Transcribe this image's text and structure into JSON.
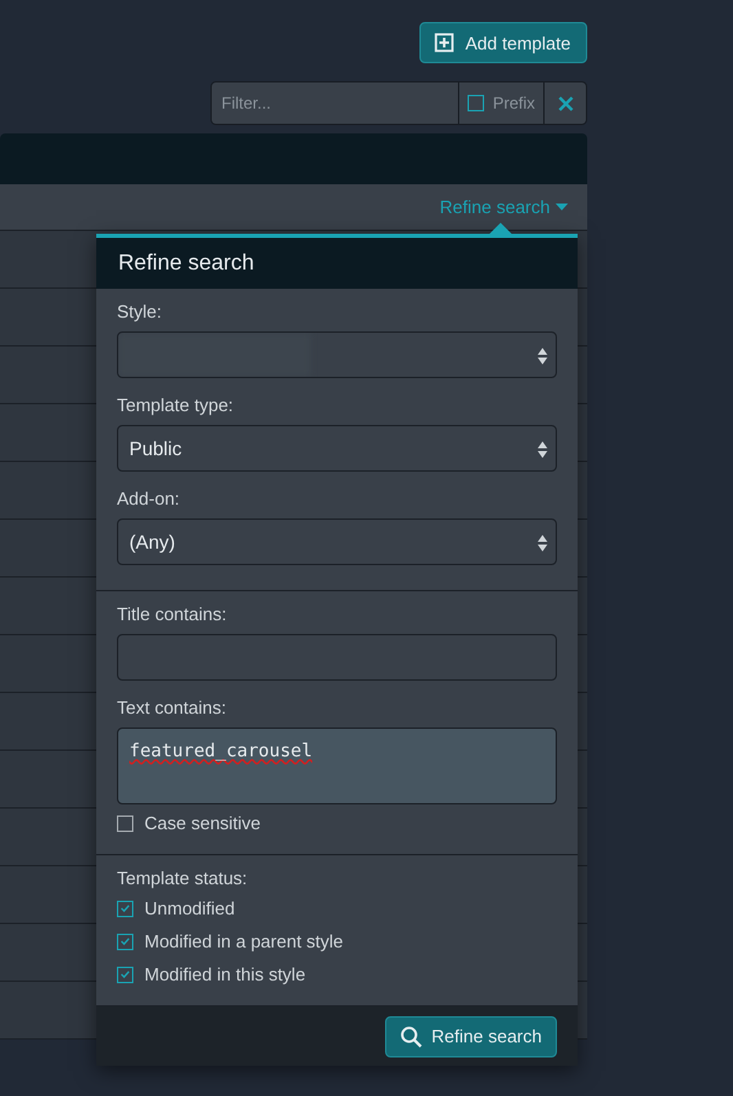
{
  "toolbar": {
    "add_button": "Add template"
  },
  "filter": {
    "placeholder": "Filter...",
    "prefix": {
      "label": "Prefix",
      "checked": false
    }
  },
  "list": {
    "refine_link": "Refine search"
  },
  "refine_popup": {
    "title": "Refine search",
    "sections": [
      {
        "items": [
          {
            "kind": "select",
            "label": "Style:",
            "redacted": true
          },
          {
            "kind": "select",
            "label": "Template type:",
            "value": "Public"
          },
          {
            "kind": "select",
            "label": "Add-on:",
            "value": "(Any)"
          }
        ]
      },
      {
        "items": [
          {
            "kind": "text",
            "label": "Title contains:"
          },
          {
            "kind": "textarea",
            "label": "Text contains:",
            "value": "featured_carousel"
          },
          {
            "kind": "checkbox",
            "label": "Case sensitive",
            "checked": false
          }
        ]
      },
      {
        "items": [
          {
            "kind": "heading",
            "label": "Template status:"
          },
          {
            "kind": "checkbox",
            "label": "Unmodified",
            "checked": true
          },
          {
            "kind": "checkbox",
            "label": "Modified in a parent style",
            "checked": true
          },
          {
            "kind": "checkbox",
            "label": "Modified in this style",
            "checked": true
          }
        ]
      }
    ],
    "submit_button": "Refine search"
  }
}
